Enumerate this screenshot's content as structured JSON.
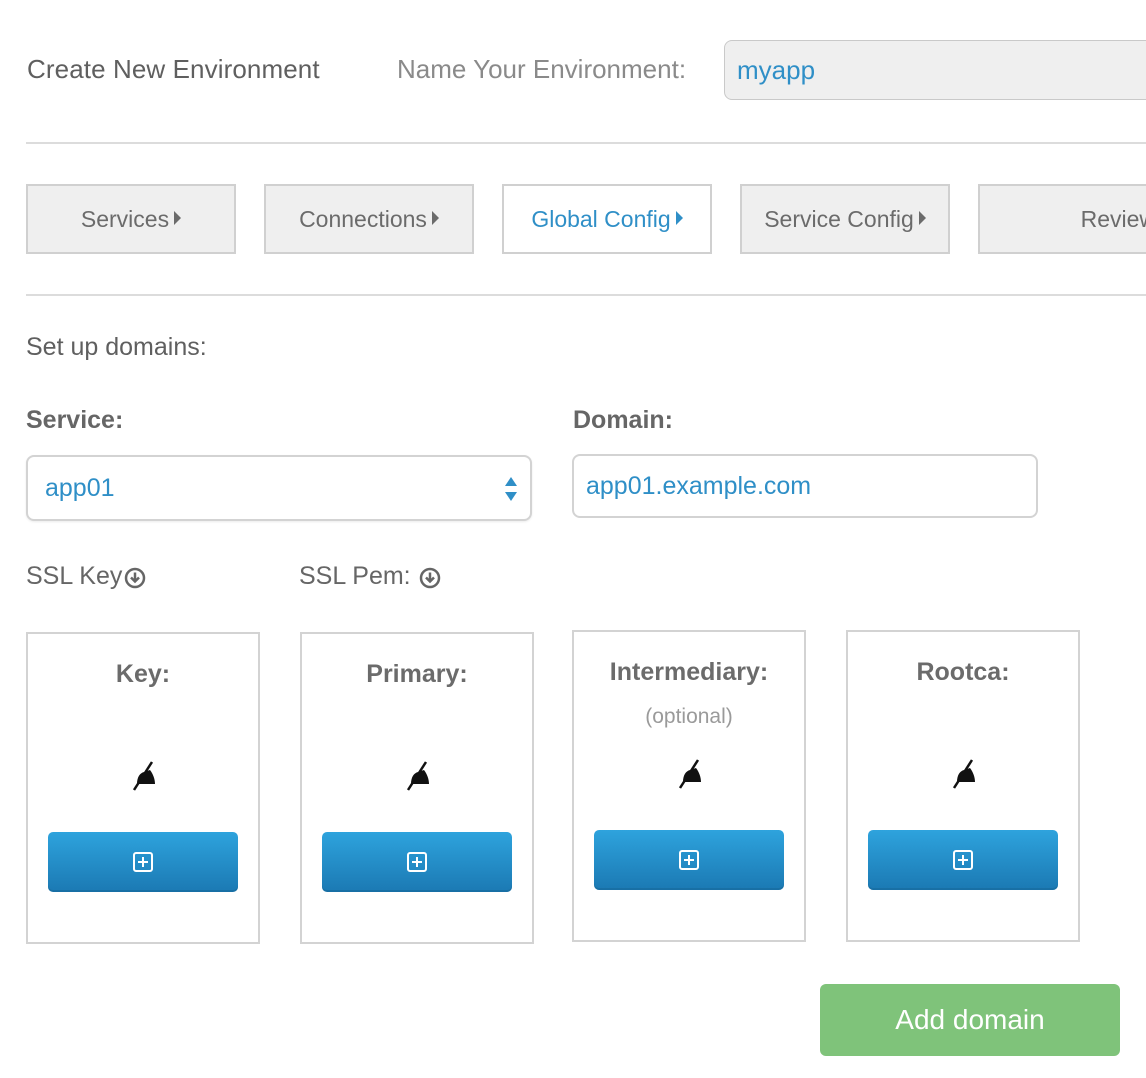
{
  "header": {
    "title": "Create New Environment",
    "name_label": "Name Your Environment:",
    "env_name": "myapp"
  },
  "steps": [
    {
      "label": "Services"
    },
    {
      "label": "Connections"
    },
    {
      "label": "Global Config",
      "active": true
    },
    {
      "label": "Service Config"
    },
    {
      "label": "Review"
    }
  ],
  "form": {
    "section_label": "Set up domains:",
    "service_label": "Service:",
    "service_value": "app01",
    "domain_label": "Domain:",
    "domain_value": "app01.example.com",
    "ssl_key_label": "SSL Key",
    "ssl_pem_label": "SSL Pem:"
  },
  "cards": [
    {
      "title": "Key:",
      "status_icon": "no-file-icon",
      "button_icon": "plus-square-icon"
    },
    {
      "title": "Primary:",
      "status_icon": "no-file-icon",
      "button_icon": "plus-square-icon"
    },
    {
      "title": "Intermediary:",
      "subtitle": "(optional)",
      "status_icon": "no-file-icon",
      "button_icon": "plus-square-icon"
    },
    {
      "title": "Rootca:",
      "status_icon": "no-file-icon",
      "button_icon": "plus-square-icon"
    }
  ],
  "actions": {
    "add_domain": "Add domain"
  },
  "colors": {
    "accent_blue": "#2f8fc7",
    "button_blue": "#1f8bc8",
    "success_green": "#7fc37a",
    "step_bg": "#efefef"
  }
}
